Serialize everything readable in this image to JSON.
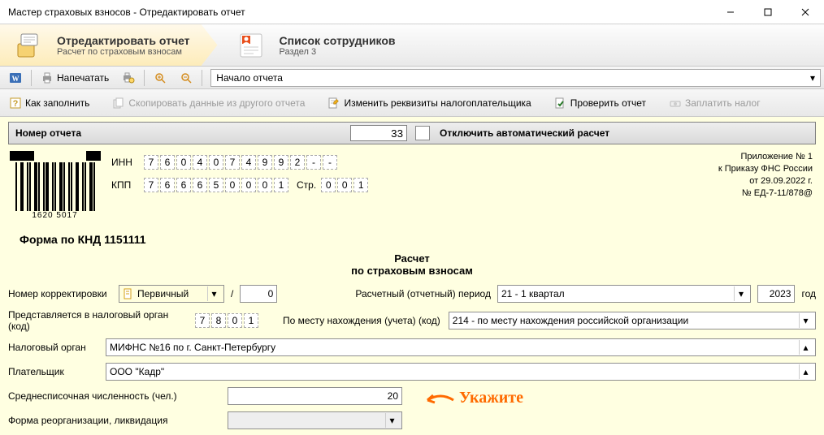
{
  "window": {
    "title": "Мастер страховых взносов - Отредактировать отчет"
  },
  "wizard": {
    "step1": {
      "title": "Отредактировать отчет",
      "sub": "Расчет по страховым взносам"
    },
    "step2": {
      "title": "Список сотрудников",
      "sub": "Раздел 3"
    }
  },
  "toolbar1": {
    "print": "Напечатать",
    "section_combo": "Начало отчета"
  },
  "toolbar2": {
    "how": "Как заполнить",
    "copy": "Скопировать данные из другого отчета",
    "edit_req": "Изменить реквизиты налогоплательщика",
    "check": "Проверить отчет",
    "pay": "Заплатить налог"
  },
  "header": {
    "report_num_label": "Номер отчета",
    "report_num": "33",
    "autocalc_off": "Отключить автоматический расчет"
  },
  "barcode_num": "1620 5017",
  "inn": {
    "label": "ИНН",
    "digits": [
      "7",
      "6",
      "0",
      "4",
      "0",
      "7",
      "4",
      "9",
      "9",
      "2",
      "-",
      "-"
    ]
  },
  "kpp": {
    "label": "КПП",
    "digits": [
      "7",
      "6",
      "6",
      "6",
      "5",
      "0",
      "0",
      "0",
      "1"
    ],
    "page_label": "Стр.",
    "page": [
      "0",
      "0",
      "1"
    ]
  },
  "annex": {
    "l1": "Приложение № 1",
    "l2": "к Приказу ФНС России",
    "l3": "от 29.09.2022 г.",
    "l4": "№ ЕД-7-11/878@"
  },
  "form_knd": "Форма по КНД 1151111",
  "title_main": "Расчет",
  "title_sub": "по страховым взносам",
  "fields": {
    "corr_label": "Номер корректировки",
    "corr_kind": "Первичный",
    "corr_num": "0",
    "period_label": "Расчетный (отчетный) период",
    "period_val": "21 - 1 квартал",
    "year": "2023",
    "year_label": "год",
    "tax_org_code_label": "Представляется в налоговый орган (код)",
    "tax_org_code": [
      "7",
      "8",
      "0",
      "1"
    ],
    "place_label": "По месту нахождения (учета) (код)",
    "place_val": "214 - по месту нахождения российской организации",
    "tax_org_label": "Налоговый орган",
    "tax_org_val": "МИФНС №16 по г. Санкт-Петербургу",
    "payer_label": "Плательщик",
    "payer_val": "ООО \"Кадр\"",
    "avg_label": "Среднесписочная численность (чел.)",
    "avg_val": "20",
    "reorg_label": "Форма реорганизации, ликвидация"
  },
  "annotation": {
    "text": "Укажите"
  }
}
